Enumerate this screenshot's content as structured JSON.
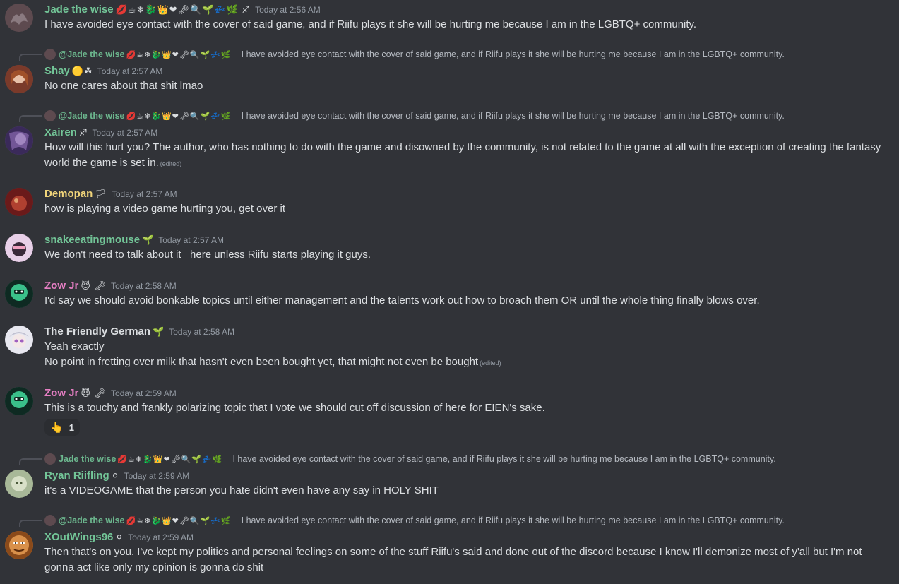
{
  "messages": [
    {
      "username": "Jade the wise",
      "username_color": "#73c698",
      "emojis": "💋☕❄🐉👑❤🗝🔍🌱💤🌿 ♐",
      "timestamp": "Today at 2:56 AM",
      "content": "I have avoided eye contact with the cover of said game, and if Riifu plays it she will be hurting me because I am in the LGBTQ+ community.",
      "avatar_color": "#5d4a4f"
    },
    {
      "reply": {
        "name": "@Jade the wise",
        "emojis": "💋☕❄🐉👑❤🗝🔍🌱💤🌿",
        "text": "I have avoided eye contact with the cover of said game, and if Riifu plays it she will be hurting me because I am in the LGBTQ+ community."
      },
      "username": "Shay",
      "username_color": "#73c698",
      "emojis": "🟡☘",
      "timestamp": "Today at 2:57 AM",
      "content": "No one cares about that shit lmao",
      "avatar_color": "#8a4a3a"
    },
    {
      "reply": {
        "name": "@Jade the wise",
        "emojis": "💋☕❄🐉👑❤🗝🔍🌱💤🌿",
        "text": "I have avoided eye contact with the cover of said game, and if Riifu plays it she will be hurting me because I am in the LGBTQ+ community."
      },
      "username": "Xairen",
      "username_color": "#73c698",
      "emojis": "♐",
      "timestamp": "Today at 2:57 AM",
      "content": "How will this hurt you? The author, who has nothing to do with the game and disowned by the community, is not related to the game at all with the exception of creating the fantasy world the game is set in.",
      "edited": "(edited)",
      "avatar_color": "#5a4a7a"
    },
    {
      "username": "Demopan",
      "username_color": "#f0d47a",
      "emojis": "🏳",
      "timestamp": "Today at 2:57 AM",
      "content": "how is playing a video game hurting you, get over it",
      "avatar_color": "#8a2a2a"
    },
    {
      "username": "snakeeatingmouse",
      "username_color": "#73c698",
      "emojis": "🌱",
      "timestamp": "Today at 2:57 AM",
      "content": "We don't need to talk about it   here unless Riifu starts playing it guys.",
      "avatar_color": "#6a4a6a"
    },
    {
      "username": "Zow Jr",
      "username_color": "#e67fc4",
      "emojis": "😈 🗝",
      "timestamp": "Today at 2:58 AM",
      "content": "I'd say we should avoid bonkable topics until either management and the talents work out how to broach them OR until the whole thing finally blows over.",
      "avatar_color": "#1e5a48"
    },
    {
      "username": "The Friendly German",
      "username_color": "#dbdee1",
      "emojis": "🌱",
      "timestamp": "Today at 2:58 AM",
      "content": "Yeah exactly",
      "content2": "No point in fretting over milk that hasn't even been bought yet, that might not even be bought",
      "edited": "(edited)",
      "avatar_color": "#c8c8d8"
    },
    {
      "username": "Zow Jr",
      "username_color": "#e67fc4",
      "emojis": "😈 🗝",
      "timestamp": "Today at 2:59 AM",
      "content": "This is a touchy and frankly polarizing topic that I vote we should cut off discussion of here for EIEN's sake.",
      "reaction": {
        "emoji": "👆",
        "count": "1"
      },
      "avatar_color": "#1e5a48"
    },
    {
      "reply": {
        "name": "Jade the wise",
        "emojis": "💋☕❄🐉👑❤🗝🔍🌱💤🌿",
        "text": "I have avoided eye contact with the cover of said game, and if Riifu plays it she will be hurting me because I am in the LGBTQ+ community."
      },
      "username": "Ryan Riifling",
      "username_color": "#73c698",
      "emojis": "⚪",
      "timestamp": "Today at 2:59 AM",
      "content": "it's a VIDEOGAME that the person you hate didn't even have any say in HOLY SHIT",
      "avatar_color": "#9ab08a"
    },
    {
      "reply": {
        "name": "@Jade the wise",
        "emojis": "💋☕❄🐉👑❤🗝🔍🌱💤🌿",
        "text": "I have avoided eye contact with the cover of said game, and if Riifu plays it she will be hurting me because I am in the LGBTQ+ community."
      },
      "username": "XOutWings96",
      "username_color": "#73c698",
      "emojis": "⚪",
      "timestamp": "Today at 2:59 AM",
      "content": "Then that's on you. I've kept my politics and personal feelings on some of the stuff Riifu's said and done out of the discord because I know I'll demonize most of y'all but I'm not gonna act like only my opinion is gonna do shit",
      "avatar_color": "#c87a3a"
    }
  ]
}
